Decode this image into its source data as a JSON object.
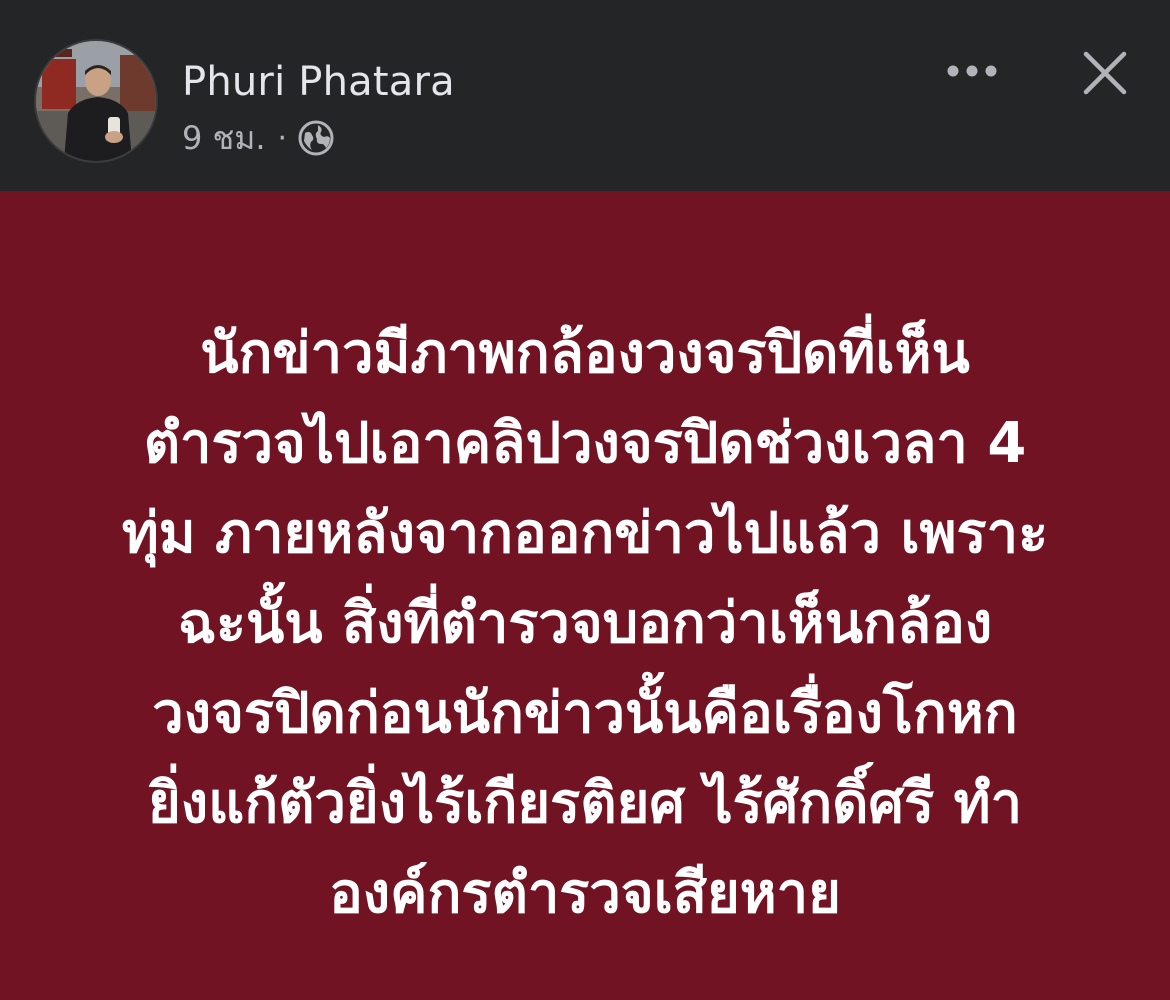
{
  "header": {
    "author_name": "Phuri Phatara",
    "time_ago": "9 ชม.",
    "separator": "·",
    "privacy_icon": "globe-icon",
    "more_icon": "more-horizontal-icon",
    "close_icon": "close-icon",
    "background_color": "#242526"
  },
  "post": {
    "background_color": "#721324",
    "text_color": "#ffffff",
    "lines": [
      "นักข่าวมีภาพกล้องวงจรปิดที่เห็น",
      "ตำรวจไปเอาคลิปวงจรปิดช่วงเวลา 4",
      "ทุ่ม ภายหลังจากออกข่าวไปแล้ว เพราะ",
      "ฉะนั้น สิ่งที่ตำรวจบอกว่าเห็นกล้อง",
      "วงจรปิดก่อนนักข่าวนั้นคือเรื่องโกหก",
      "ยิ่งแก้ตัวยิ่งไร้เกียรติยศ ไร้ศักดิ์ศรี ทำ",
      "องค์กรตำรวจเสียหาย"
    ]
  }
}
